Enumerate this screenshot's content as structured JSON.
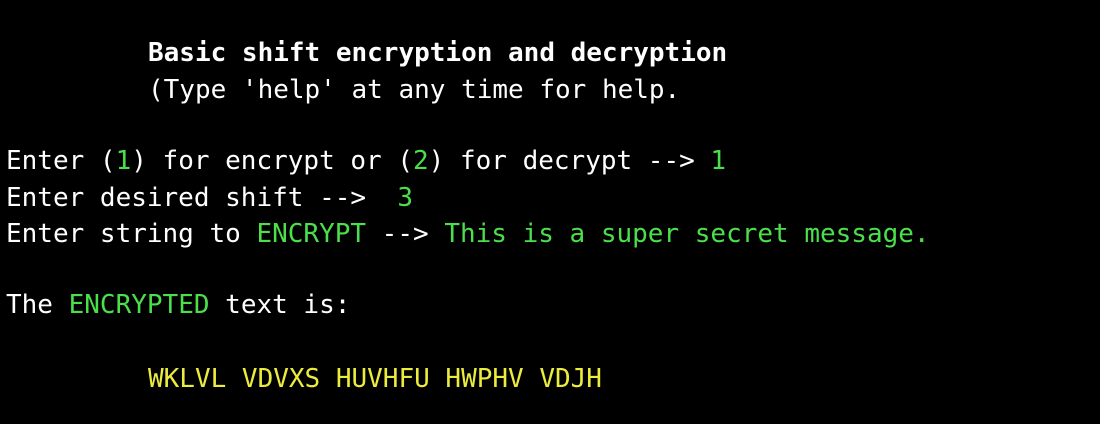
{
  "colors": {
    "background": "#000000",
    "text": "#ffffff",
    "highlight_green": "#4be04b",
    "output_yellow": "#ecec3c"
  },
  "header": {
    "title": "Basic shift encryption and decryption",
    "help_hint": "(Type 'help' at any time for help."
  },
  "prompts": {
    "mode": {
      "prefix": "Enter (",
      "option1": "1",
      "middle": ") for encrypt or (",
      "option2": "2",
      "suffix": ") for decrypt --> ",
      "answer": "1"
    },
    "shift": {
      "label": "Enter desired shift -->  ",
      "answer": "3"
    },
    "string": {
      "prefix": "Enter string to ",
      "keyword": "ENCRYPT",
      "arrow": " --> ",
      "answer": "This is a super secret message."
    }
  },
  "result": {
    "prefix": "The ",
    "keyword": "ENCRYPTED",
    "suffix": " text is:",
    "output": "WKLVL VDVXS HUVHFU HWPHV VDJH"
  }
}
